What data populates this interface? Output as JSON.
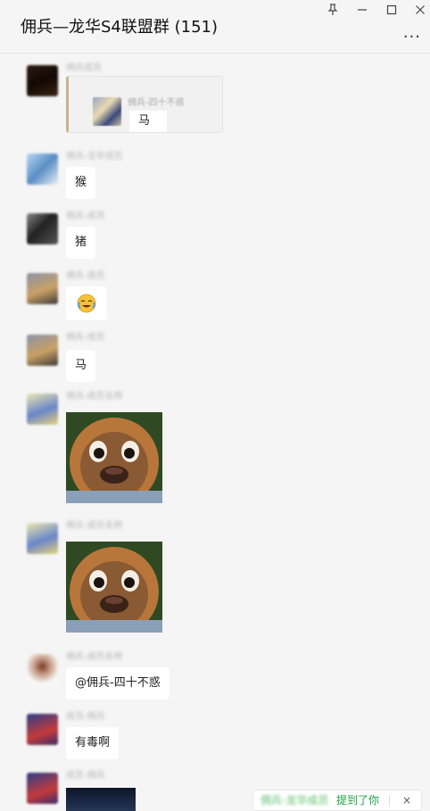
{
  "window": {
    "title": "佣兵—龙华S4联盟群 (151)",
    "pin_icon": "pin-icon",
    "minimize_icon": "minimize-icon",
    "maximize_icon": "maximize-icon",
    "close_icon": "close-icon",
    "more_label": "..."
  },
  "messages": [
    {
      "type": "quote",
      "quoted_name": "佣兵-四十不惑",
      "quoted_text": "马"
    },
    {
      "type": "text",
      "text": "猴"
    },
    {
      "type": "text",
      "text": "猪"
    },
    {
      "type": "emoji",
      "emoji": "crying-laughing-emoji"
    },
    {
      "type": "text",
      "text": "马"
    },
    {
      "type": "sticker",
      "sticker": "cartoon-bear-face"
    },
    {
      "type": "sticker",
      "sticker": "cartoon-bear-face"
    },
    {
      "type": "text",
      "text": "@佣兵-四十不惑"
    },
    {
      "type": "text",
      "text": "有毒啊"
    },
    {
      "type": "image",
      "image": "screenshot-thumbnail"
    }
  ],
  "mention_toast": {
    "mention_text": "提到了你",
    "close_label": "×"
  },
  "colors": {
    "background": "#f5f5f5",
    "bubble": "#ffffff",
    "mention_green": "#1fa24a"
  }
}
